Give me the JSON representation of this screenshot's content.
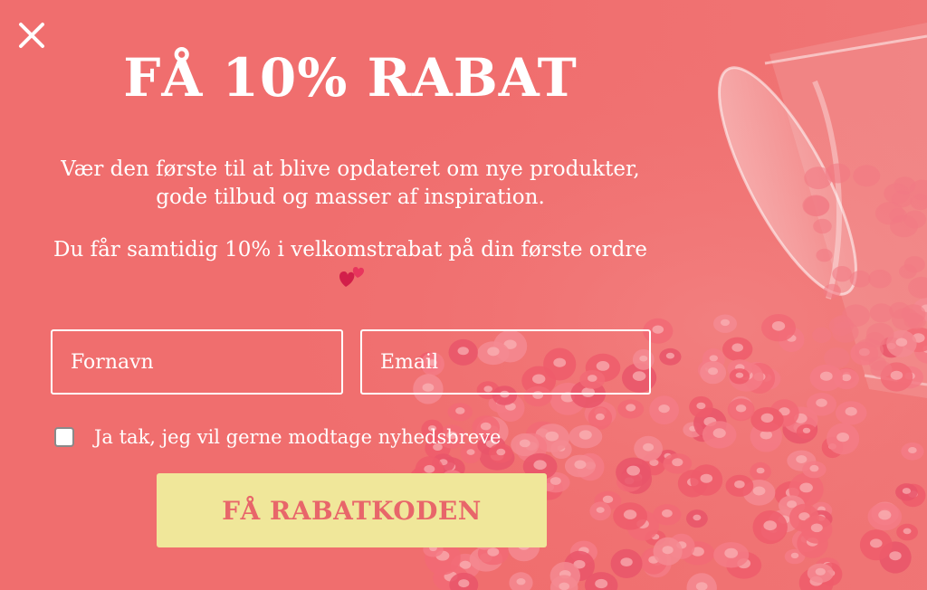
{
  "popup": {
    "title": "FÅ 10% RABAT",
    "subtitle": "Vær den første til at blive opdateret om nye produkter, gode tilbud og masser af inspiration.",
    "offer_text": "Du får samtidig 10% i velkomstrabat på din første ordre",
    "form": {
      "first_name_placeholder": "Fornavn",
      "email_placeholder": "Email",
      "consent_label": "Ja tak, jeg vil gerne modtage nyhedsbreve",
      "consent_checked": false,
      "submit_label": "FÅ RABATKODEN"
    }
  },
  "colors": {
    "background": "#f06e6e",
    "button": "#f0e79a",
    "button_text": "#e8666a",
    "text": "#ffffff"
  },
  "icons": {
    "close": "close-icon",
    "hearts": "two-hearts-emoji"
  }
}
